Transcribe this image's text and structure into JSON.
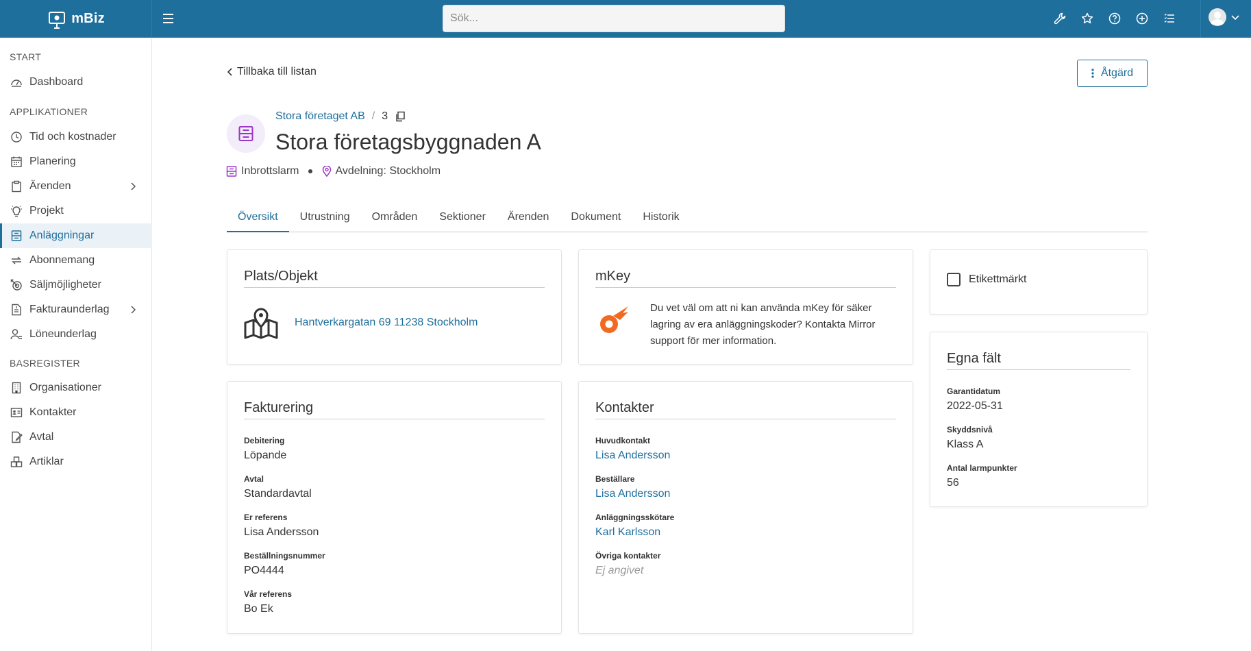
{
  "app": {
    "name": "mBiz"
  },
  "search": {
    "placeholder": "Sök..."
  },
  "topbar": {
    "icons": [
      "wrench-icon",
      "star-icon",
      "help-icon",
      "add-circle-icon",
      "list-icon"
    ],
    "accent": "#1f6f9c"
  },
  "sidebar": {
    "sections": [
      {
        "header": "START",
        "items": [
          {
            "label": "Dashboard",
            "icon": "dashboard-icon"
          }
        ]
      },
      {
        "header": "APPLIKATIONER",
        "items": [
          {
            "label": "Tid och kostnader",
            "icon": "clock-icon"
          },
          {
            "label": "Planering",
            "icon": "calendar-icon"
          },
          {
            "label": "Ärenden",
            "icon": "clipboard-icon",
            "expandable": true
          },
          {
            "label": "Projekt",
            "icon": "lightbulb-icon"
          },
          {
            "label": "Anläggningar",
            "icon": "cabinet-icon",
            "active": true
          },
          {
            "label": "Abonnemang",
            "icon": "repeat-icon"
          },
          {
            "label": "Säljmöjligheter",
            "icon": "target-icon"
          },
          {
            "label": "Fakturaunderlag",
            "icon": "invoice-icon",
            "expandable": true
          },
          {
            "label": "Löneunderlag",
            "icon": "payroll-icon"
          }
        ]
      },
      {
        "header": "BASREGISTER",
        "items": [
          {
            "label": "Organisationer",
            "icon": "building-icon"
          },
          {
            "label": "Kontakter",
            "icon": "contact-card-icon"
          },
          {
            "label": "Avtal",
            "icon": "contract-icon"
          },
          {
            "label": "Artiklar",
            "icon": "boxes-icon"
          }
        ]
      }
    ]
  },
  "page": {
    "back_label": "Tillbaka till listan",
    "action_label": "Åtgärd",
    "breadcrumb": {
      "org": "Stora företaget AB",
      "separator": "/",
      "id": "3"
    },
    "title": "Stora företagsbyggnaden A",
    "type_label": "Inbrottslarm",
    "department_label": "Avdelning: Stockholm"
  },
  "tabs": [
    "Översikt",
    "Utrustning",
    "Områden",
    "Sektioner",
    "Ärenden",
    "Dokument",
    "Historik"
  ],
  "location_card": {
    "title": "Plats/Objekt",
    "address": "Hantverkargatan 69 11238 Stockholm"
  },
  "mkey_card": {
    "title": "mKey",
    "text": "Du vet väl om att ni kan använda mKey för säker lagring av era anläggningskoder? Kontakta Mirror support för mer information.",
    "brand_color": "#f26a21"
  },
  "tag_card": {
    "label": "Etikettmärkt",
    "checked": false
  },
  "billing_card": {
    "title": "Fakturering",
    "fields": [
      {
        "label": "Debitering",
        "value": "Löpande"
      },
      {
        "label": "Avtal",
        "value": "Standardavtal"
      },
      {
        "label": "Er referens",
        "value": "Lisa Andersson"
      },
      {
        "label": "Beställningsnummer",
        "value": "PO4444"
      },
      {
        "label": "Vår referens",
        "value": "Bo Ek"
      }
    ]
  },
  "contacts_card": {
    "title": "Kontakter",
    "fields": [
      {
        "label": "Huvudkontakt",
        "value": "Lisa Andersson"
      },
      {
        "label": "Beställare",
        "value": "Lisa Andersson"
      },
      {
        "label": "Anläggningsskötare",
        "value": "Karl Karlsson"
      },
      {
        "label": "Övriga kontakter",
        "value": "Ej angivet"
      }
    ]
  },
  "custom_fields_card": {
    "title": "Egna fält",
    "fields": [
      {
        "label": "Garantidatum",
        "value": "2022-05-31"
      },
      {
        "label": "Skyddsnivå",
        "value": "Klass A"
      },
      {
        "label": "Antal larmpunkter",
        "value": "56"
      }
    ]
  }
}
